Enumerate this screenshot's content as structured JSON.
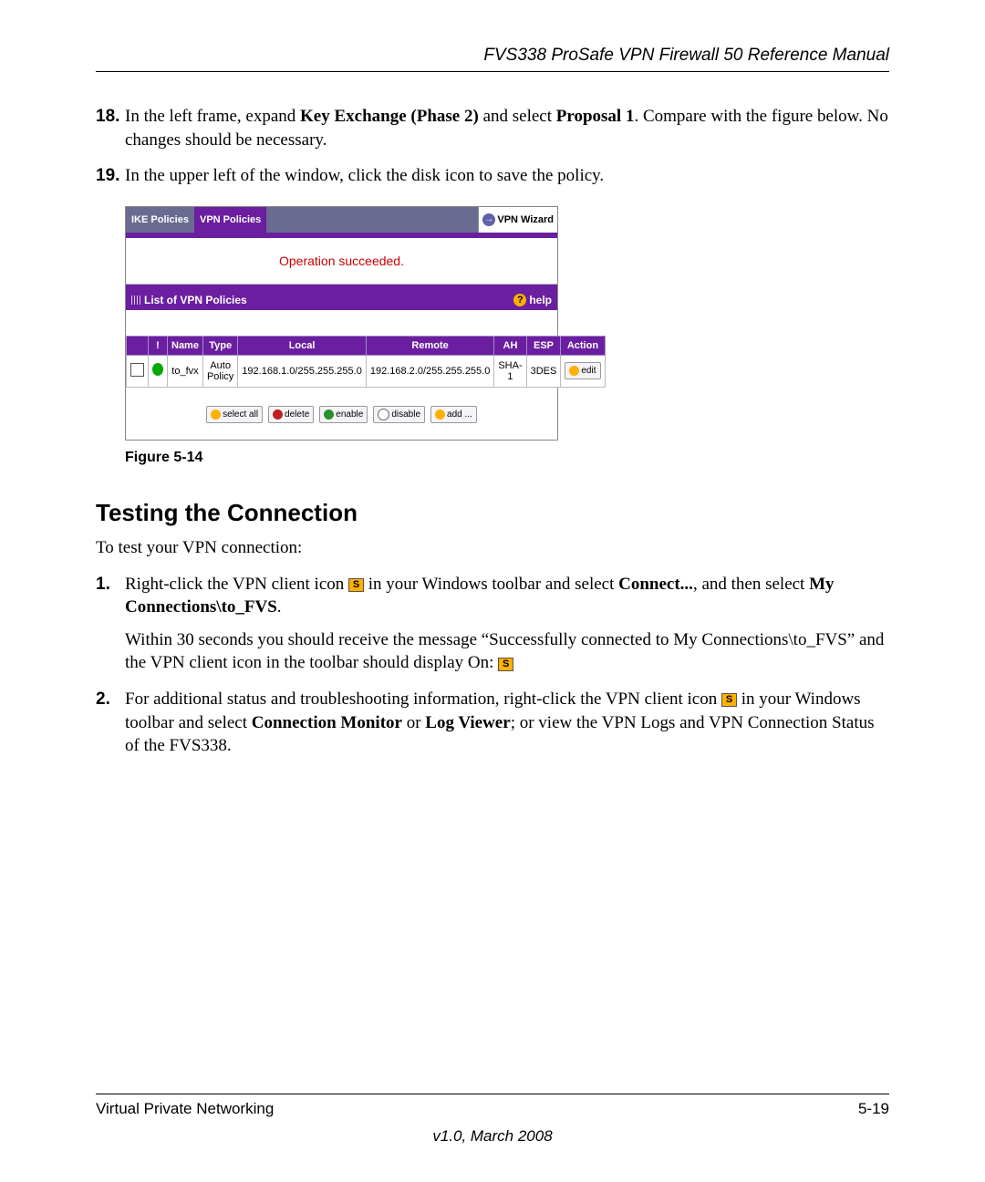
{
  "header": {
    "title": "FVS338 ProSafe VPN Firewall 50 Reference Manual"
  },
  "steps": {
    "s18": {
      "num": "18.",
      "pre": "In the left frame, expand ",
      "bold1": "Key Exchange (Phase 2)",
      "mid": " and select ",
      "bold2": "Proposal 1",
      "post": ". Compare with the figure below. No changes should be necessary."
    },
    "s19": {
      "num": "19.",
      "text": "In the upper left of the window, click the disk icon to save the policy."
    }
  },
  "screenshot": {
    "tabs": {
      "ike": "IKE Policies",
      "vpn": "VPN Policies",
      "wizard": "VPN Wizard"
    },
    "op_msg": "Operation succeeded.",
    "list_title": "List of VPN Policies",
    "help": "help",
    "columns": {
      "bang": "!",
      "name": "Name",
      "type": "Type",
      "local": "Local",
      "remote": "Remote",
      "ah": "AH",
      "esp": "ESP",
      "action": "Action"
    },
    "row": {
      "name": "to_fvx",
      "type": "Auto Policy",
      "local": "192.168.1.0/255.255.255.0",
      "remote": "192.168.2.0/255.255.255.0",
      "ah": "SHA-1",
      "esp": "3DES",
      "action_label": "edit"
    },
    "buttons": {
      "select_all": "select all",
      "delete": "delete",
      "enable": "enable",
      "disable": "disable",
      "add": "add ..."
    }
  },
  "figure_caption": "Figure 5-14",
  "section_heading": "Testing the Connection",
  "intro": "To test your VPN connection:",
  "steps2": {
    "s1": {
      "num": "1.",
      "pre": "Right-click the VPN client icon ",
      "mid1": " in your Windows toolbar and select ",
      "bold1": "Connect...",
      "mid2": ", and then select ",
      "bold2": "My Connections\\to_FVS",
      "post": ".",
      "sub": "Within 30 seconds you should receive the message “Successfully connected to My Connections\\to_FVS” and the VPN client icon in the toolbar should display On: ",
      "iconS": "S"
    },
    "s2": {
      "num": "2.",
      "pre": "For additional status and troubleshooting information, right-click the VPN client icon ",
      "mid1": " in your Windows toolbar and select ",
      "bold1": "Connection Monitor",
      "or": " or ",
      "bold2": "Log Viewer",
      "post": "; or view the VPN Logs and VPN Connection Status of the FVS338.",
      "iconS": "S"
    }
  },
  "footer": {
    "left": "Virtual Private Networking",
    "right": "5-19",
    "version": "v1.0, March 2008"
  }
}
